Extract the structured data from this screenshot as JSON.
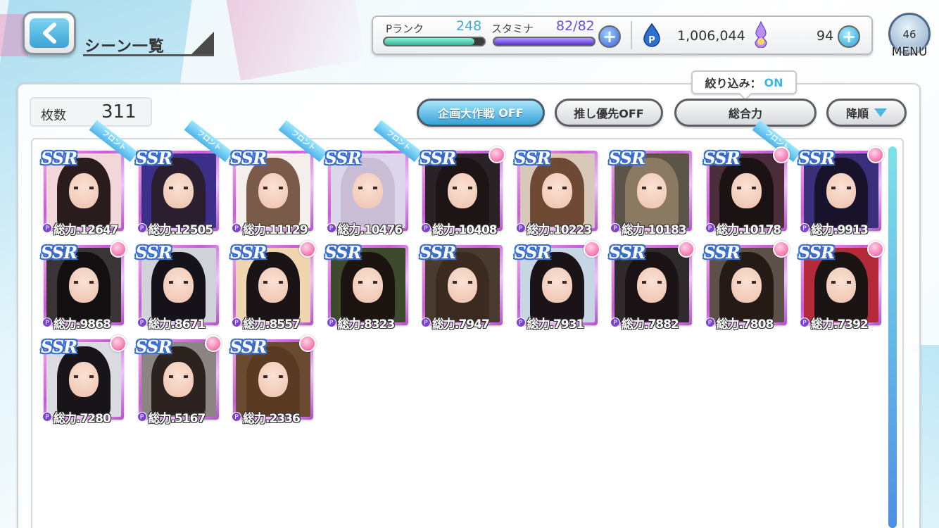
{
  "header": {
    "title": "シーン一覧"
  },
  "status": {
    "rank_label": "Pランク",
    "rank_value": "248",
    "rank_progress": 0.9,
    "stamina_label": "スタミナ",
    "stamina_value": "82/82",
    "stamina_progress": 1.0,
    "coins": "1,006,044",
    "gems": "94"
  },
  "menu": {
    "level": "46",
    "label": "MENU"
  },
  "toolbar": {
    "count_label": "枚数",
    "count_value": "311",
    "filter_label": "絞り込み：",
    "filter_state": "ON",
    "kikaku_label": "企画大作戦",
    "kikaku_state": "OFF",
    "oshi_label": "推し優先OFF",
    "sort_label": "総合力",
    "order_label": "降順"
  },
  "cards": [
    {
      "rarity": "SSR",
      "power": "総力.12647",
      "badge": "ribbon",
      "ribbon": "フロント",
      "bg": "#f3d6da",
      "hair": "#2a1c1c"
    },
    {
      "rarity": "SSR",
      "power": "総力.12505",
      "badge": "ribbon",
      "ribbon": "フロント",
      "bg": "#3c2f8a",
      "hair": "#2b1f2f"
    },
    {
      "rarity": "SSR",
      "power": "総力.11129",
      "badge": "ribbon",
      "ribbon": "フロント",
      "bg": "#f5efec",
      "hair": "#7a5a48"
    },
    {
      "rarity": "SSR",
      "power": "総力.10476",
      "badge": "ribbon",
      "ribbon": "フロント",
      "bg": "#dcd6ea",
      "hair": "#c9bdd6"
    },
    {
      "rarity": "SSR",
      "power": "総力.10408",
      "badge": "dot",
      "ribbon": "",
      "bg": "#2a2226",
      "hair": "#1d1416"
    },
    {
      "rarity": "SSR",
      "power": "総力.10223",
      "badge": "none",
      "ribbon": "",
      "bg": "#d8c8b9",
      "hair": "#6e4a34"
    },
    {
      "rarity": "SSR",
      "power": "総力.10183",
      "badge": "none",
      "ribbon": "",
      "bg": "#5b5549",
      "hair": "#8a7a62"
    },
    {
      "rarity": "SSR",
      "power": "総力.10178",
      "badge": "ribbon-dot",
      "ribbon": "フロント",
      "bg": "#4a2c3a",
      "hair": "#1b1214"
    },
    {
      "rarity": "SSR",
      "power": "総力.9913",
      "badge": "dot",
      "ribbon": "",
      "bg": "#3a2f7a",
      "hair": "#18122a"
    },
    {
      "rarity": "SSR",
      "power": "総力.9868",
      "badge": "dot",
      "ribbon": "",
      "bg": "#3a3436",
      "hair": "#141012"
    },
    {
      "rarity": "SSR",
      "power": "総力.8671",
      "badge": "none",
      "ribbon": "",
      "bg": "#cfd2d8",
      "hair": "#15121a"
    },
    {
      "rarity": "SSR",
      "power": "総力.8557",
      "badge": "dot",
      "ribbon": "",
      "bg": "#efd6b0",
      "hair": "#1a1416"
    },
    {
      "rarity": "SSR",
      "power": "総力.8323",
      "badge": "none",
      "ribbon": "",
      "bg": "#3d4a2e",
      "hair": "#1c1410"
    },
    {
      "rarity": "SSR",
      "power": "総力.7947",
      "badge": "none",
      "ribbon": "",
      "bg": "#4a3b30",
      "hair": "#3b2a20"
    },
    {
      "rarity": "SSR",
      "power": "総力.7931",
      "badge": "dot",
      "ribbon": "",
      "bg": "#c7d6e4",
      "hair": "#1a1418"
    },
    {
      "rarity": "SSR",
      "power": "総力.7882",
      "badge": "dot",
      "ribbon": "",
      "bg": "#2f2a2c",
      "hair": "#1a1214"
    },
    {
      "rarity": "SSR",
      "power": "総力.7808",
      "badge": "dot",
      "ribbon": "",
      "bg": "#5d5048",
      "hair": "#241a16"
    },
    {
      "rarity": "SSR",
      "power": "総力.7392",
      "badge": "dot",
      "ribbon": "",
      "bg": "#b52a38",
      "hair": "#1a1414"
    },
    {
      "rarity": "SSR",
      "power": "総力.7280",
      "badge": "dot",
      "ribbon": "",
      "bg": "#d9dbe0",
      "hair": "#18141a"
    },
    {
      "rarity": "SSR",
      "power": "総力.5167",
      "badge": "dot",
      "ribbon": "",
      "bg": "#8a8482",
      "hair": "#2c2220"
    },
    {
      "rarity": "SSR",
      "power": "総力.2336",
      "badge": "dot",
      "ribbon": "",
      "bg": "#6a4a30",
      "hair": "#5a3a22"
    }
  ]
}
